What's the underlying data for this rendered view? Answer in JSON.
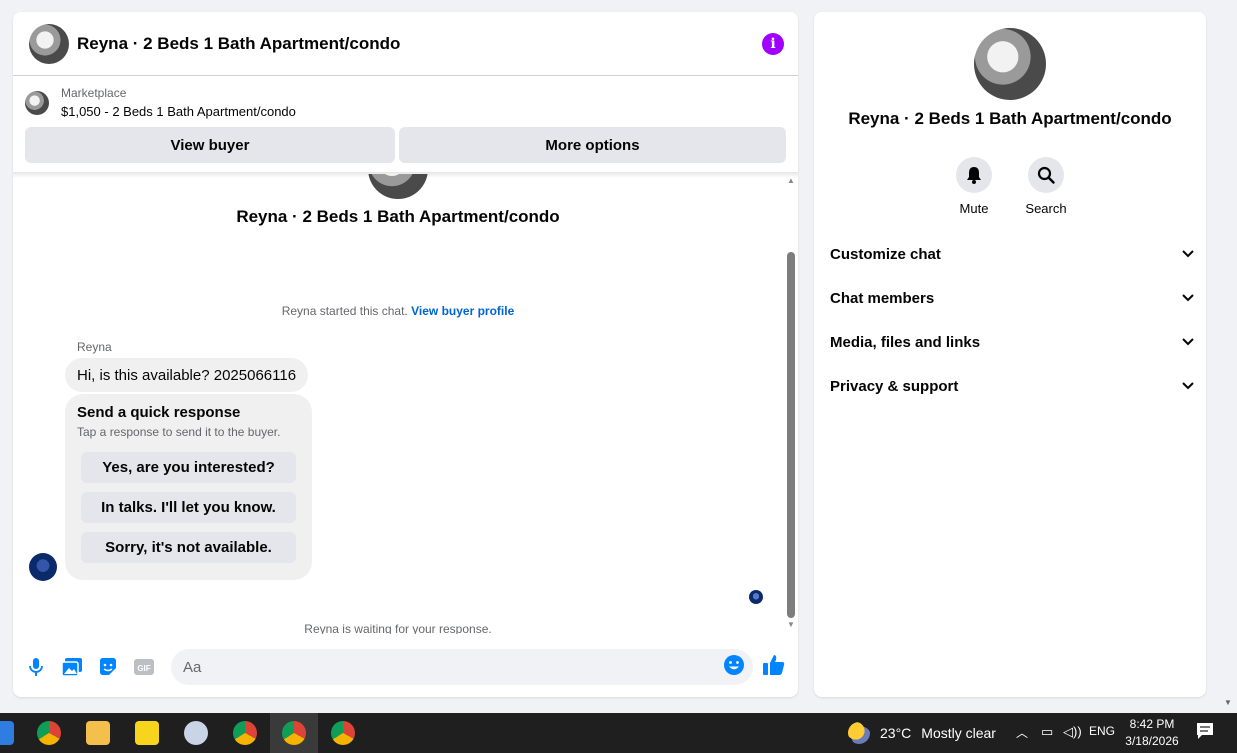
{
  "chat": {
    "title": "Reyna · 2 Beds 1 Bath Apartment/condo",
    "info_icon": "i",
    "listing": {
      "label": "Marketplace",
      "price_title": "$1,050 - 2 Beds 1 Bath Apartment/condo"
    },
    "actions": {
      "view_buyer": "View buyer",
      "more_options": "More options"
    },
    "intro_title": "Reyna · 2 Beds 1 Bath Apartment/condo",
    "system_message": "Reyna started this chat.",
    "system_link": "View buyer profile",
    "sender_name": "Reyna",
    "message": "Hi, is this available? 2025066116",
    "quick_response": {
      "title": "Send a quick response",
      "subtitle": "Tap a response to send it to the buyer.",
      "options": [
        "Yes, are you interested?",
        "In talks. I'll let you know.",
        "Sorry, it's not available."
      ]
    },
    "waiting": "Reyna is waiting for your response.",
    "composer": {
      "placeholder": "Aa",
      "tools": [
        "microphone-icon",
        "photo-icon",
        "sticker-icon",
        "gif-icon"
      ],
      "gif_label": "GIF"
    }
  },
  "info_panel": {
    "title": "Reyna · 2 Beds 1 Bath Apartment/condo",
    "mute_label": "Mute",
    "search_label": "Search",
    "sections": [
      "Customize chat",
      "Chat members",
      "Media, files and links",
      "Privacy & support"
    ]
  },
  "taskbar": {
    "weather_temp": "23°C",
    "weather_text": "Mostly clear",
    "language": "ENG",
    "time": "8:42 PM",
    "date": "3/18/2026"
  },
  "colors": {
    "accent_link": "#0064d1",
    "info_purple": "#a100ff",
    "messenger_blue": "#0084ff"
  }
}
